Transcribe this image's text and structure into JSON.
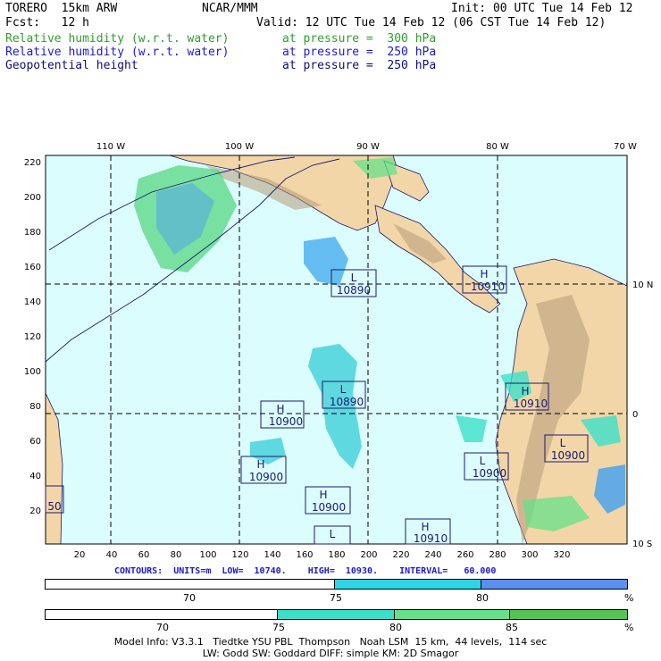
{
  "header": {
    "model": "TORERO  15km ARW",
    "org": "NCAR/MMM",
    "init": "Init: 00 UTC Tue 14 Feb 12",
    "fcst": "Fcst:   12 h",
    "valid": "Valid: 12 UTC Tue 14 Feb 12 (06 CST Tue 14 Feb 12)",
    "fields": [
      {
        "name": "Relative humidity (w.r.t. water)",
        "level": "at pressure =  300 hPa",
        "color": "#2e9e2e"
      },
      {
        "name": "Relative humidity (w.r.t. water)",
        "level": "at pressure =  250 hPa",
        "color": "#1a1ad0"
      },
      {
        "name": "Geopotential height",
        "level": "at pressure =  250 hPa",
        "color": "#101070"
      }
    ]
  },
  "map": {
    "lon_labels": [
      "110 W",
      "100 W",
      "90 W",
      "80 W",
      "70 W"
    ],
    "lat_labels": [
      "10 N",
      "0",
      "10 S"
    ],
    "x_ticks": [
      "20",
      "40",
      "60",
      "80",
      "100",
      "120",
      "140",
      "160",
      "180",
      "200",
      "220",
      "240",
      "260",
      "280",
      "300",
      "320"
    ],
    "y_ticks": [
      "220",
      "200",
      "180",
      "160",
      "140",
      "120",
      "100",
      "80",
      "60",
      "40",
      "20"
    ],
    "centers": [
      {
        "type": "L",
        "value": "10890"
      },
      {
        "type": "H",
        "value": "10910"
      },
      {
        "type": "L",
        "value": "10890"
      },
      {
        "type": "H",
        "value": "10900"
      },
      {
        "type": "H",
        "value": "10910"
      },
      {
        "type": "L",
        "value": "10900"
      },
      {
        "type": "H",
        "value": "10900"
      },
      {
        "type": "L",
        "value": "10900"
      },
      {
        "type": "H",
        "value": "10900"
      },
      {
        "type": "L",
        "value": ""
      },
      {
        "type": "H",
        "value": "10910"
      },
      {
        "type": "",
        "value": "50"
      }
    ]
  },
  "contours_line": "CONTOURS:  UNITS=m  LOW=  10740.    HIGH=  10930.    INTERVAL=   60.000",
  "colorbar1": {
    "labels": [
      "70",
      "75",
      "80",
      "%"
    ],
    "colors": [
      "#ffffff",
      "#2fd4e6",
      "#5b8ff0"
    ]
  },
  "colorbar2": {
    "labels": [
      "70",
      "75",
      "80",
      "85",
      "%"
    ],
    "colors": [
      "#ffffff",
      "#3ae0c8",
      "#66e08a",
      "#55c455"
    ]
  },
  "footer": {
    "line1": "Model Info: V3.3.1   Tiedtke YSU PBL  Thompson   Noah LSM  15 km,  44 levels,  114 sec",
    "line2": "LW: Godd SW: Goddard DIFF: simple KM: 2D Smagor"
  }
}
